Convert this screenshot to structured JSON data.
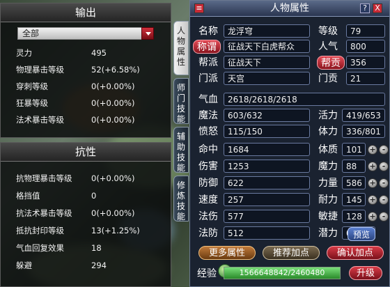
{
  "output_panel": {
    "title": "输出",
    "filter_value": "全部",
    "rows": [
      {
        "k": "灵力",
        "v": "495"
      },
      {
        "k": "物理暴击等级",
        "v": "52(+6.58%)"
      },
      {
        "k": "穿刺等级",
        "v": "0(+0.00%)"
      },
      {
        "k": "狂暴等级",
        "v": "0(+0.00%)"
      },
      {
        "k": "法术暴击等级",
        "v": "0(+0.00%)"
      }
    ]
  },
  "resist_panel": {
    "title": "抗性",
    "rows": [
      {
        "k": "抗物理暴击等级",
        "v": "0(+0.00%)"
      },
      {
        "k": "格挡值",
        "v": "0"
      },
      {
        "k": "抗法术暴击等级",
        "v": "0(+0.00%)"
      },
      {
        "k": "抵抗封印等级",
        "v": "13(+1.25%)"
      },
      {
        "k": "气血回复效果",
        "v": "18"
      },
      {
        "k": "躲避",
        "v": "294"
      }
    ]
  },
  "side_tabs": [
    "人物属性",
    "师门技能",
    "辅助技能",
    "修炼技能"
  ],
  "char": {
    "title": "人物属性",
    "help": "?",
    "close": "X",
    "name_label": "名称",
    "name": "龙浮穹",
    "level_label": "等级",
    "level": "79",
    "title_label": "称谓",
    "title_value": "征战天下白虎帮众",
    "pop_label": "人气",
    "pop": "800",
    "guild_label": "帮派",
    "guild": "征战天下",
    "guild_contrib_label": "帮贡",
    "guild_contrib": "356",
    "school_label": "门派",
    "school": "天宫",
    "school_contrib_label": "门贡",
    "school_contrib": "21",
    "hp_label": "气血",
    "hp": "2618/2618/2618",
    "mp_label": "魔法",
    "mp": "603/632",
    "vit_label": "活力",
    "vit": "419/653",
    "anger_label": "愤怒",
    "anger": "115/150",
    "sta_label": "体力",
    "sta": "336/801",
    "stats": [
      {
        "k": "命中",
        "v": "1684",
        "ak": "体质",
        "av": "101"
      },
      {
        "k": "伤害",
        "v": "1253",
        "ak": "魔力",
        "av": "88"
      },
      {
        "k": "防御",
        "v": "622",
        "ak": "力量",
        "av": "586"
      },
      {
        "k": "速度",
        "v": "257",
        "ak": "耐力",
        "av": "145"
      },
      {
        "k": "法伤",
        "v": "577",
        "ak": "敏捷",
        "av": "128"
      },
      {
        "k": "法防",
        "v": "512",
        "ak": "潜力",
        "av": "0"
      }
    ],
    "preview_label": "预览",
    "more_attr": "更多属性",
    "recommend": "推荐加点",
    "confirm": "确认加点",
    "exp_label": "经验",
    "exp": "1566648842/2460480",
    "exp_fill": 1.0,
    "levelup": "升级",
    "plus": "+",
    "minus": "-"
  }
}
